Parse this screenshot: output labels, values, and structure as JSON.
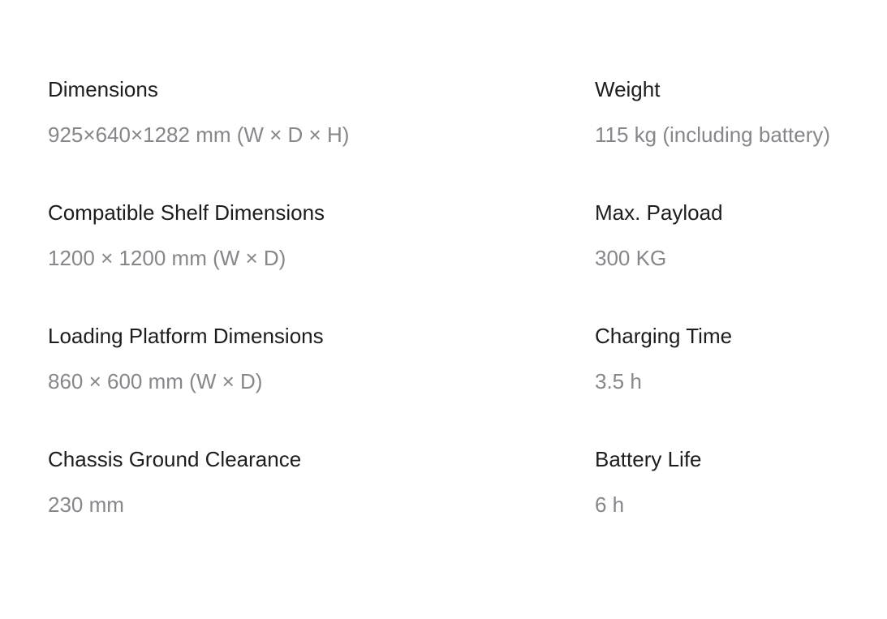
{
  "specs": [
    {
      "label": "Dimensions",
      "value": "925×640×1282 mm (W × D × H)"
    },
    {
      "label": "Weight",
      "value": "115 kg (including battery)"
    },
    {
      "label": "Compatible Shelf Dimensions",
      "value": "1200 × 1200 mm (W × D)"
    },
    {
      "label": "Max. Payload",
      "value": "300 KG"
    },
    {
      "label": "Loading Platform Dimensions",
      "value": "860 × 600 mm (W × D)"
    },
    {
      "label": "Charging Time",
      "value": "3.5 h"
    },
    {
      "label": "Chassis Ground Clearance",
      "value": "230 mm"
    },
    {
      "label": "Battery Life",
      "value": "6 h"
    }
  ]
}
